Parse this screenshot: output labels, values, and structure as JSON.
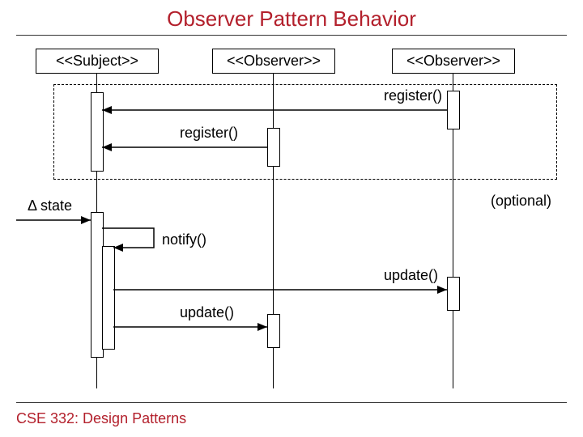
{
  "title": "Observer Pattern Behavior",
  "footer": "CSE 332: Design Patterns",
  "participants": {
    "subject": "<<Subject>>",
    "observer1": "<<Observer>>",
    "observer2": "<<Observer>>"
  },
  "messages": {
    "register1": "register()",
    "register2": "register()",
    "notify": "notify()",
    "update1": "update()",
    "update2": "update()"
  },
  "annotations": {
    "delta_state": "Δ state",
    "optional": "(optional)"
  },
  "chart_data": {
    "type": "sequence-diagram",
    "title": "Observer Pattern Behavior",
    "participants": [
      {
        "name": "Subject",
        "stereotype": "<<Subject>>"
      },
      {
        "name": "Observer1",
        "stereotype": "<<Observer>>"
      },
      {
        "name": "Observer2",
        "stereotype": "<<Observer>>"
      }
    ],
    "fragments": [
      {
        "kind": "opt",
        "label": "(optional)",
        "covers_messages": [
          "register-obs2",
          "register-obs1"
        ]
      }
    ],
    "messages": [
      {
        "id": "register-obs2",
        "from": "Observer2",
        "to": "Subject",
        "label": "register()"
      },
      {
        "id": "register-obs1",
        "from": "Observer1",
        "to": "Subject",
        "label": "register()"
      },
      {
        "id": "delta-state",
        "from": "external",
        "to": "Subject",
        "label": "Δ state"
      },
      {
        "id": "notify",
        "from": "Subject",
        "to": "Subject",
        "label": "notify()",
        "self": true
      },
      {
        "id": "update-obs2",
        "from": "Subject",
        "to": "Observer2",
        "label": "update()"
      },
      {
        "id": "update-obs1",
        "from": "Subject",
        "to": "Observer1",
        "label": "update()"
      }
    ]
  }
}
